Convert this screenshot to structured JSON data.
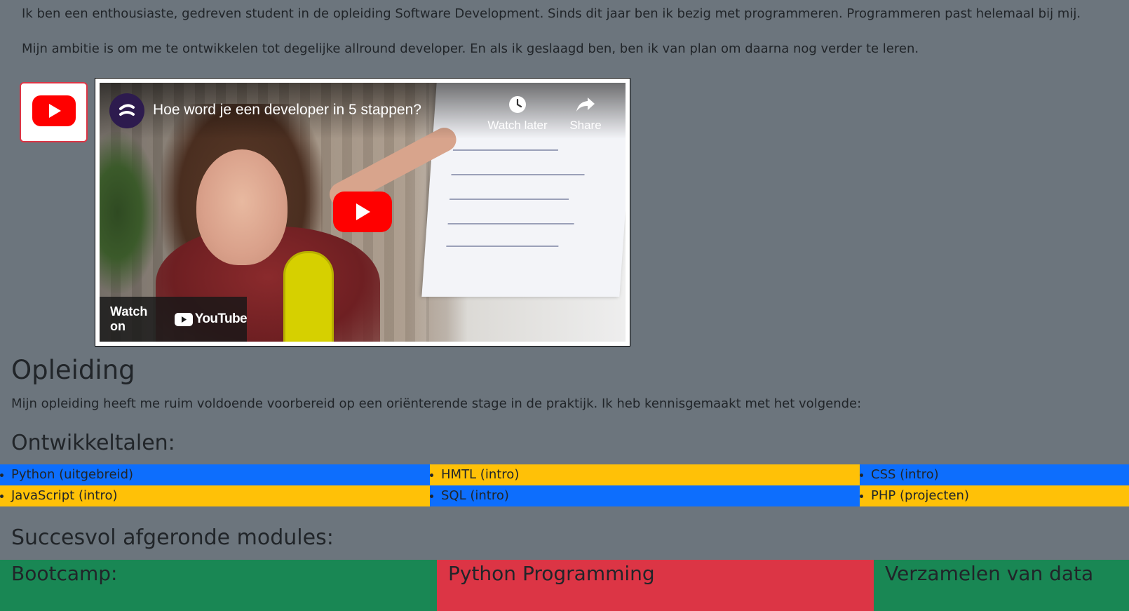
{
  "intro": {
    "p1": "Ik ben een enthousiaste, gedreven student in de opleiding Software Development. Sinds dit jaar ben ik bezig met programmeren. Programmeren past helemaal bij mij.",
    "p2": "Mijn ambitie is om me te ontwikkelen tot degelijke allround developer. En als ik geslaagd ben, ben ik van plan om daarna nog verder te leren."
  },
  "video": {
    "title": "Hoe word je een developer in 5 stappen?",
    "watch_later": "Watch later",
    "share": "Share",
    "watch_on": "Watch on",
    "youtube_word": "YouTube",
    "icons": [
      "youtube-icon",
      "channel-avatar",
      "clock-icon",
      "share-icon",
      "play-icon",
      "youtube-logo-icon"
    ]
  },
  "opleiding": {
    "heading": "Opleiding",
    "text": "Mijn opleiding heeft me ruim voldoende voorbereid op een oriënterende stage in de praktijk. Ik heb kennisgemaakt met het volgende:"
  },
  "ontwikkeltalen": {
    "heading": "Ontwikkeltalen:",
    "items": [
      "Python (uitgebreid)",
      "HMTL (intro)",
      "CSS (intro)",
      "JavaScript (intro)",
      "SQL (intro)",
      "PHP (projecten)"
    ]
  },
  "modules": {
    "heading": "Succesvol afgeronde modules:",
    "items": [
      "Bootcamp:",
      "Python Programming",
      "Verzamelen van data"
    ]
  },
  "colors": {
    "background": "#6c757d",
    "blue": "#0d6efd",
    "yellow": "#ffc107",
    "green": "#198754",
    "red": "#dc3545",
    "youtube_red": "#ff0000"
  }
}
